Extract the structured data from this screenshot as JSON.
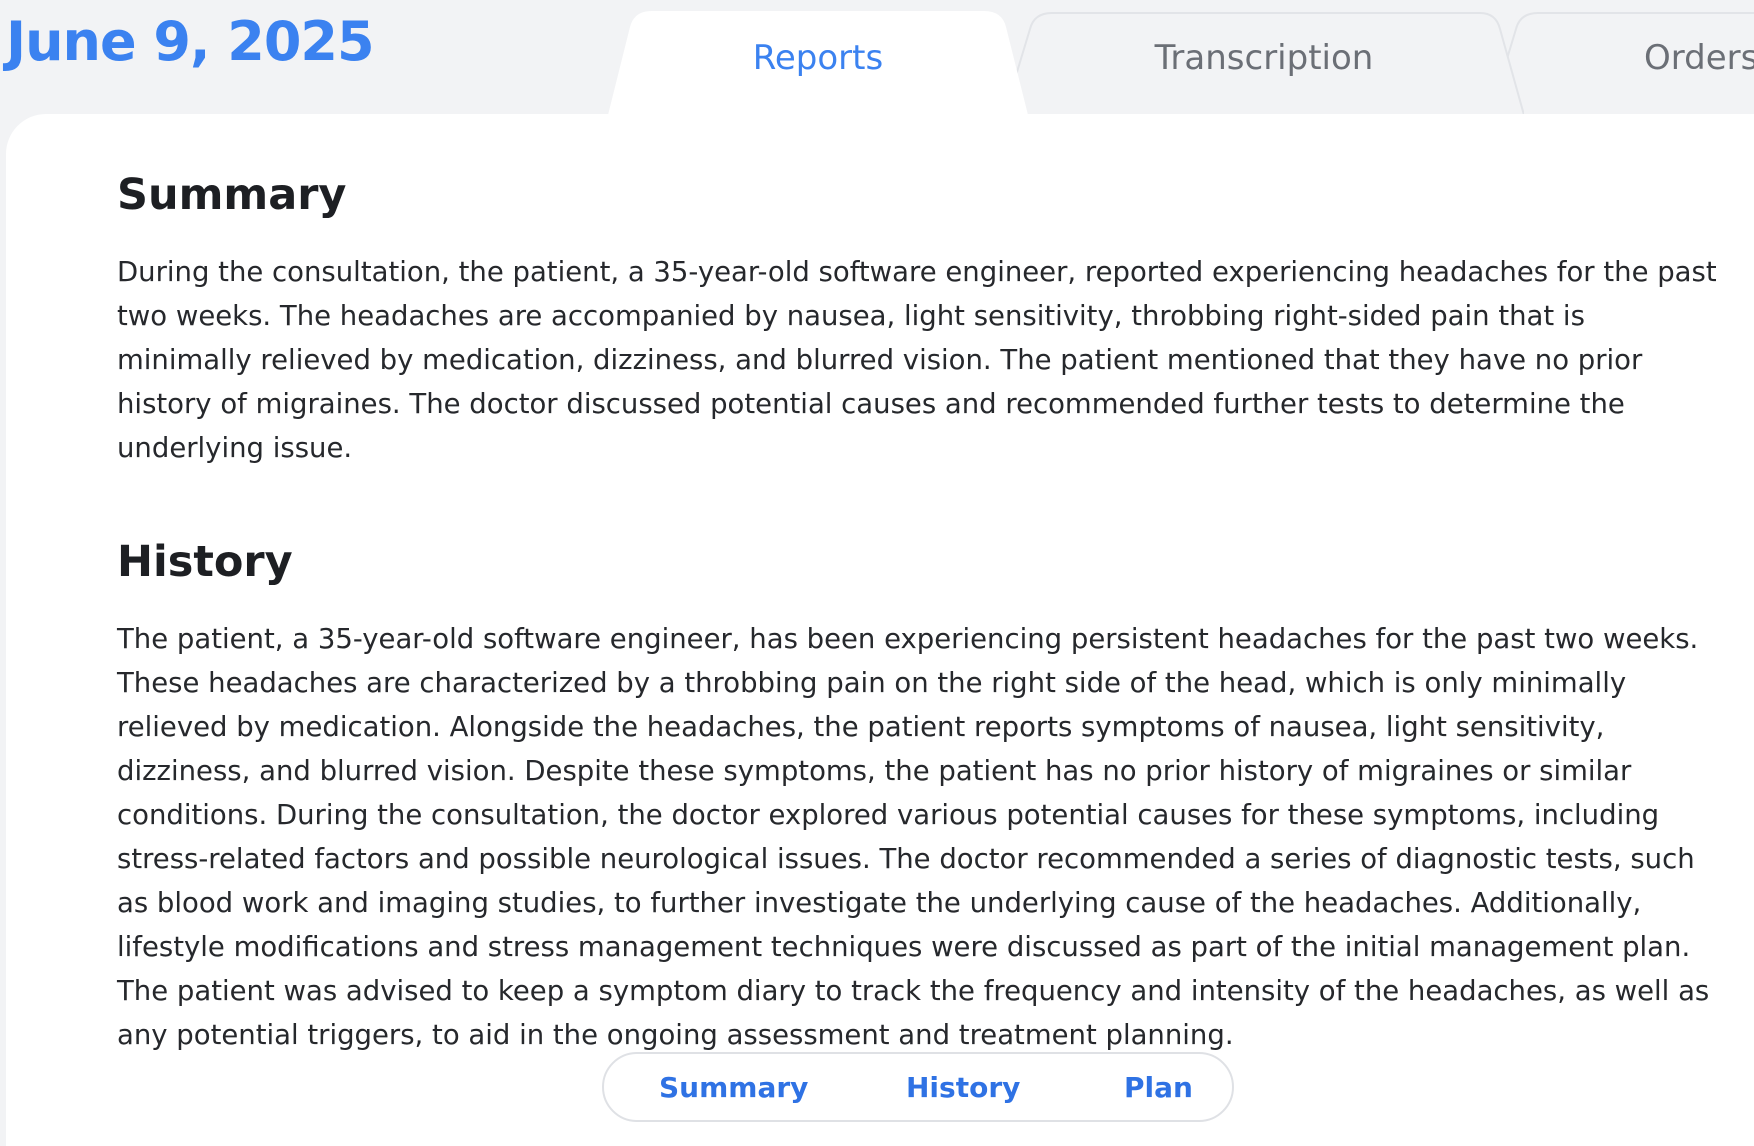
{
  "header": {
    "date": "June 9, 2025"
  },
  "tabs": [
    {
      "label": "Reports",
      "active": true
    },
    {
      "label": "Transcription",
      "active": false
    },
    {
      "label": "Orders",
      "active": false
    }
  ],
  "report": {
    "summary": {
      "title": "Summary",
      "body": "During the consultation, the patient, a 35-year-old software engineer, reported experiencing headaches for the past two weeks. The headaches are accompanied by nausea, light sensitivity, throbbing right-sided pain that is minimally relieved by medication, dizziness, and blurred vision. The patient mentioned that they have no prior history of migraines. The doctor discussed potential causes and recommended further tests to determine the underlying issue."
    },
    "history": {
      "title": "History",
      "body": "The patient, a 35-year-old software engineer, has been experiencing persistent headaches for the past two weeks. These headaches are characterized by a throbbing pain on the right side of the head, which is only minimally relieved by medication. Alongside the headaches, the patient reports symptoms of nausea, light sensitivity, dizziness, and blurred vision. Despite these symptoms, the patient has no prior history of migraines or similar conditions. During the consultation, the doctor explored various potential causes for these symptoms, including stress-related factors and possible neurological issues. The doctor recommended a series of diagnostic tests, such as blood work and imaging studies, to further investigate the underlying cause of the headaches. Additionally, lifestyle modifications and stress management techniques were discussed as part of the initial management plan. The patient was advised to keep a symptom diary to track the frequency and intensity of the headaches, as well as any potential triggers, to aid in the ongoing assessment and treatment planning."
    }
  },
  "section_nav": {
    "summary_label": "Summary",
    "history_label": "History",
    "plan_label": "Plan"
  },
  "colors": {
    "accent": "#3b82f0",
    "tab_inactive_bg": "#f2f3f5",
    "tab_active_bg": "#ffffff",
    "text": "#26282c"
  }
}
